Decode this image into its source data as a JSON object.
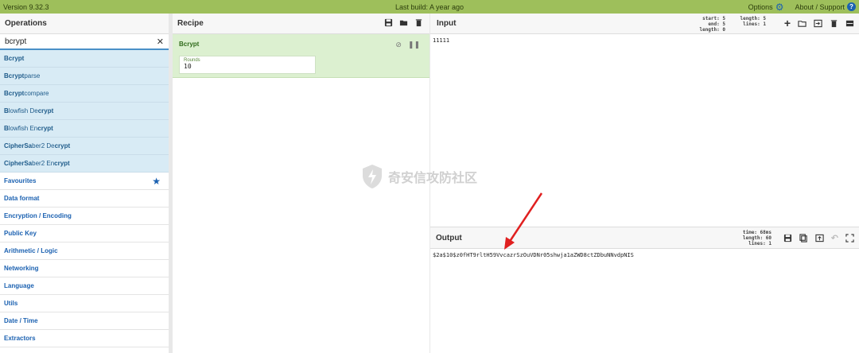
{
  "topbar": {
    "version": "Version 9.32.3",
    "last_build": "Last build: A year ago",
    "options": "Options",
    "about": "About / Support"
  },
  "operations": {
    "title": "Operations",
    "search_value": "bcrypt",
    "results": [
      {
        "pre": "",
        "match": "Bcrypt",
        "post": ""
      },
      {
        "pre": "",
        "match": "Bcrypt",
        "post": " parse"
      },
      {
        "pre": "",
        "match": "Bcrypt",
        "post": " compare"
      },
      {
        "pre": "B",
        "match": "",
        "post": "lowfish De",
        "match2": "crypt"
      },
      {
        "pre": "B",
        "match": "",
        "post": "lowfish En",
        "match2": "crypt"
      },
      {
        "pre": "CipherSa",
        "match": "",
        "post": "ber2 De",
        "match2": "crypt"
      },
      {
        "pre": "CipherSa",
        "match": "",
        "post": "ber2 En",
        "match2": "crypt"
      }
    ],
    "categories": [
      "Favourites",
      "Data format",
      "Encryption / Encoding",
      "Public Key",
      "Arithmetic / Logic",
      "Networking",
      "Language",
      "Utils",
      "Date / Time",
      "Extractors"
    ]
  },
  "recipe": {
    "title": "Recipe",
    "op_name": "Bcrypt",
    "field_label": "Rounds",
    "field_value": "10"
  },
  "input": {
    "title": "Input",
    "stats_labels": "start:\nend:\nlength:",
    "start": "5",
    "end": "5",
    "length": "0",
    "stats2_length": "5",
    "stats2_lines": "1",
    "text": "11111"
  },
  "output": {
    "title": "Output",
    "time": "68ms",
    "length": "60",
    "lines": "1",
    "text": "$2a$10$z0fHT9rltH59VvcazrSzOuVDNr05shwja1aZWD8ctZDbuNNvdpNIS"
  },
  "watermark": "奇安信攻防社区",
  "colors": {
    "accent": "#1b61b1",
    "topbar": "#9ebf5b",
    "recipe_op": "#dcf0d0",
    "search_hits": "#d8ebf5",
    "arrow": "#e02020"
  }
}
